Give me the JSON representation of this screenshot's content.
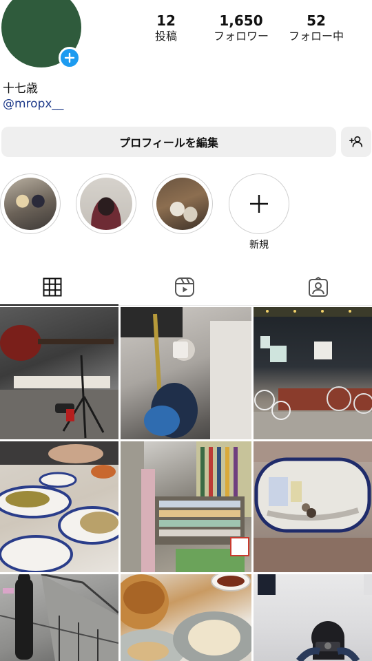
{
  "profile": {
    "display_name": "十七歳",
    "handle": "@mropx__",
    "avatar_color": "#2f5b3c"
  },
  "stats": [
    {
      "value": "12",
      "label": "投稿"
    },
    {
      "value": "1,650",
      "label": "フォロワー"
    },
    {
      "value": "52",
      "label": "フォロー中"
    }
  ],
  "actions": {
    "edit_profile_label": "プロフィールを編集",
    "suggest_icon": "person-add-icon"
  },
  "highlights": {
    "new_label": "新規",
    "items": [
      {
        "icon": "highlight-friends-photo"
      },
      {
        "icon": "highlight-portrait-photo"
      },
      {
        "icon": "highlight-table-photo"
      }
    ]
  },
  "tabs": [
    {
      "icon": "grid-icon",
      "active": true
    },
    {
      "icon": "reels-icon",
      "active": false
    },
    {
      "icon": "tagged-icon",
      "active": false
    }
  ],
  "grid": [
    {
      "subject": "guitar-street"
    },
    {
      "subject": "guitar-mirror-selfie"
    },
    {
      "subject": "bicycles-night"
    },
    {
      "subject": "chinese-food-table"
    },
    {
      "subject": "record-store"
    },
    {
      "subject": "curved-mirror"
    },
    {
      "subject": "staircase"
    },
    {
      "subject": "gyoza-plates"
    },
    {
      "subject": "camera-selfie"
    }
  ],
  "colors": {
    "accent_blue": "#1d9bf0",
    "button_bg": "#efefef",
    "handle_color": "#1e3a8a"
  }
}
